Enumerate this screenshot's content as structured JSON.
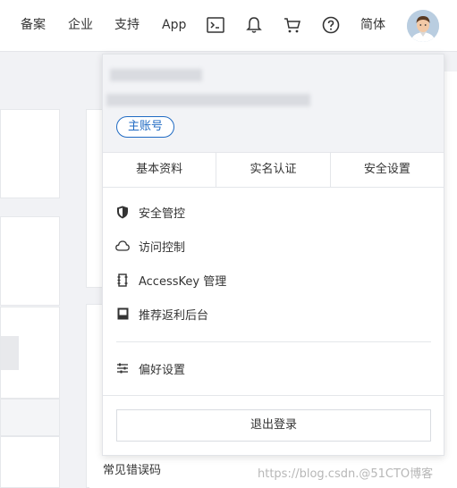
{
  "nav": {
    "items": [
      "备案",
      "企业",
      "支持",
      "App"
    ],
    "language": "简体",
    "icons": [
      "terminal-icon",
      "bell-icon",
      "cart-icon",
      "help-icon"
    ]
  },
  "background": {
    "faq_link": "常见错误码"
  },
  "watermark": "https://blog.csdn.@51CTO博客",
  "account_menu": {
    "badge": "主账号",
    "tabs": [
      "基本资料",
      "实名认证",
      "安全设置"
    ],
    "items": [
      {
        "icon": "shield-icon",
        "label": "安全管控"
      },
      {
        "icon": "cloud-icon",
        "label": "访问控制"
      },
      {
        "icon": "key-icon",
        "label": "AccessKey 管理"
      },
      {
        "icon": "referral-icon",
        "label": "推荐返利后台"
      }
    ],
    "preferences": {
      "icon": "sliders-icon",
      "label": "偏好设置"
    },
    "logout": "退出登录"
  },
  "colors": {
    "accent": "#1f6ac3",
    "header_bg": "#f2f3f6",
    "page_bg": "#f1f2f5"
  }
}
